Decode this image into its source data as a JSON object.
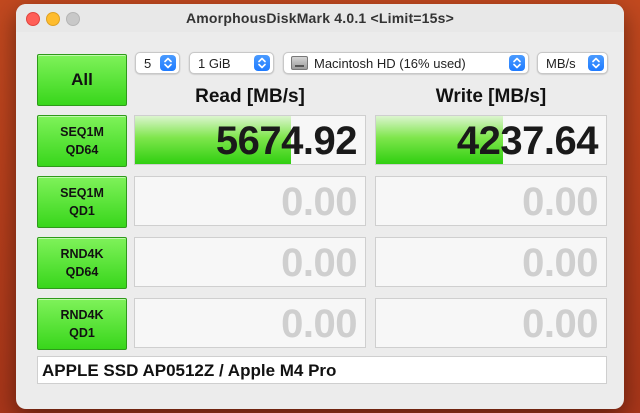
{
  "window": {
    "title": "AmorphousDiskMark 4.0.1 <Limit=15s>"
  },
  "controls": {
    "all_label": "All",
    "count": "5",
    "size": "1 GiB",
    "disk": "Macintosh HD (16% used)",
    "unit": "MB/s"
  },
  "columns": {
    "read": "Read [MB/s]",
    "write": "Write [MB/s]"
  },
  "rows": [
    {
      "label1": "SEQ1M",
      "label2": "QD64",
      "read": "5674.92",
      "write": "4237.64",
      "read_fill": 0.68,
      "write_fill": 0.55
    },
    {
      "label1": "SEQ1M",
      "label2": "QD1",
      "read": "0.00",
      "write": "0.00",
      "read_fill": 0,
      "write_fill": 0
    },
    {
      "label1": "RND4K",
      "label2": "QD64",
      "read": "0.00",
      "write": "0.00",
      "read_fill": 0,
      "write_fill": 0
    },
    {
      "label1": "RND4K",
      "label2": "QD1",
      "read": "0.00",
      "write": "0.00",
      "read_fill": 0,
      "write_fill": 0
    }
  ],
  "footer": {
    "device": "APPLE SSD AP0512Z / Apple M4 Pro"
  },
  "colors": {
    "accent_green": "#38d61b",
    "stepper_blue": "#1f7bff",
    "empty_text": "#cfcfcf"
  }
}
